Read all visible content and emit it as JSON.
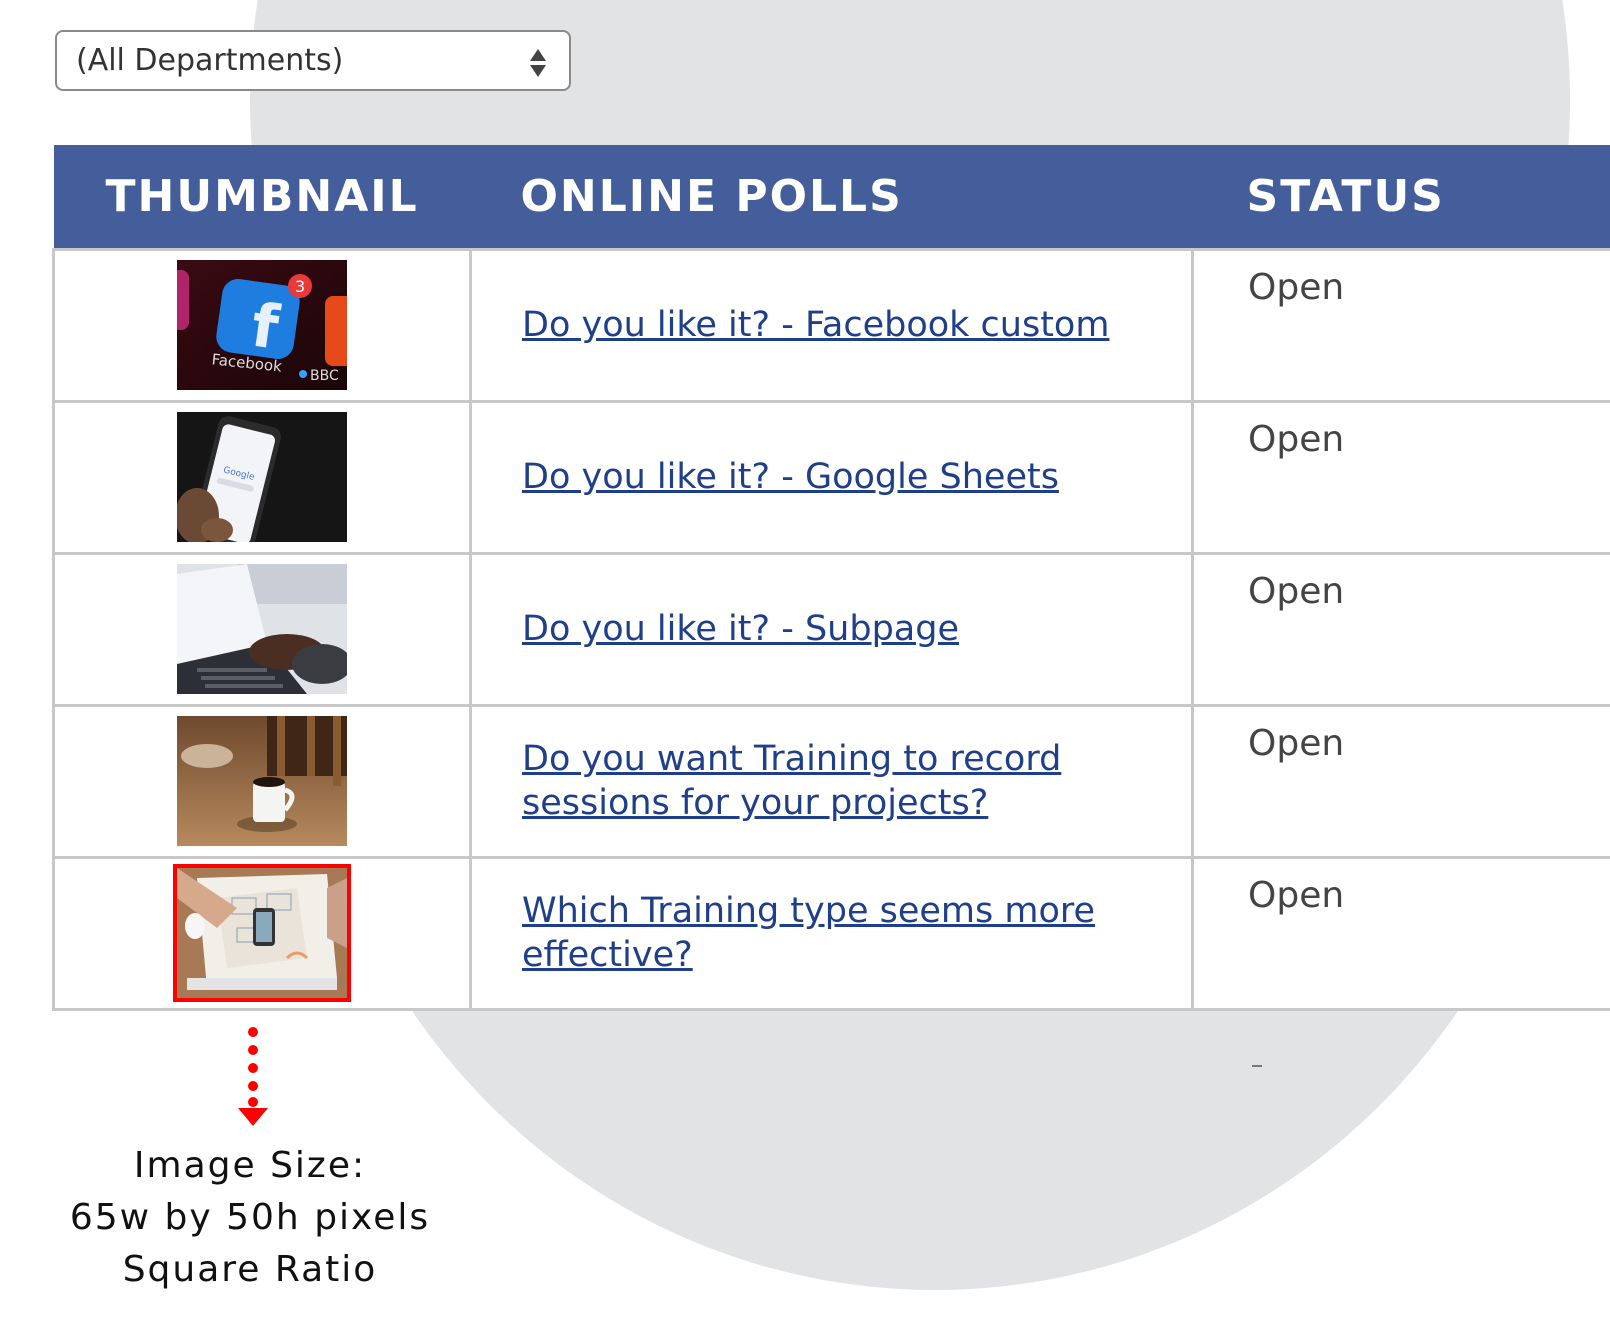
{
  "filter": {
    "selected": "(All Departments)"
  },
  "table": {
    "headers": {
      "thumbnail": "THUMBNAIL",
      "polls": "ONLINE POLLS",
      "status": "STATUS"
    },
    "rows": [
      {
        "thumbnail": "facebook-app-icon-photo",
        "poll": "Do you like it? - Facebook custom",
        "status": "Open"
      },
      {
        "thumbnail": "phone-google-photo",
        "poll": "Do you like it? - Google Sheets",
        "status": "Open"
      },
      {
        "thumbnail": "laptop-typing-photo",
        "poll": "Do you like it? - Subpage",
        "status": "Open"
      },
      {
        "thumbnail": "coffee-mug-table-photo",
        "poll": "Do you want Training to record sessions for your projects?",
        "status": "Open"
      },
      {
        "thumbnail": "desk-phone-sketches-photo",
        "poll": "Which Training type seems more effective?",
        "status": "Open"
      }
    ]
  },
  "annotation": {
    "line1": "Image Size:",
    "line2": "65w by 50h pixels",
    "line3": "Square Ratio"
  },
  "colors": {
    "header_bg": "#445e9c",
    "link": "#1f3f8a",
    "highlight": "#ff0000",
    "bg_circle": "#e2e3e5"
  }
}
